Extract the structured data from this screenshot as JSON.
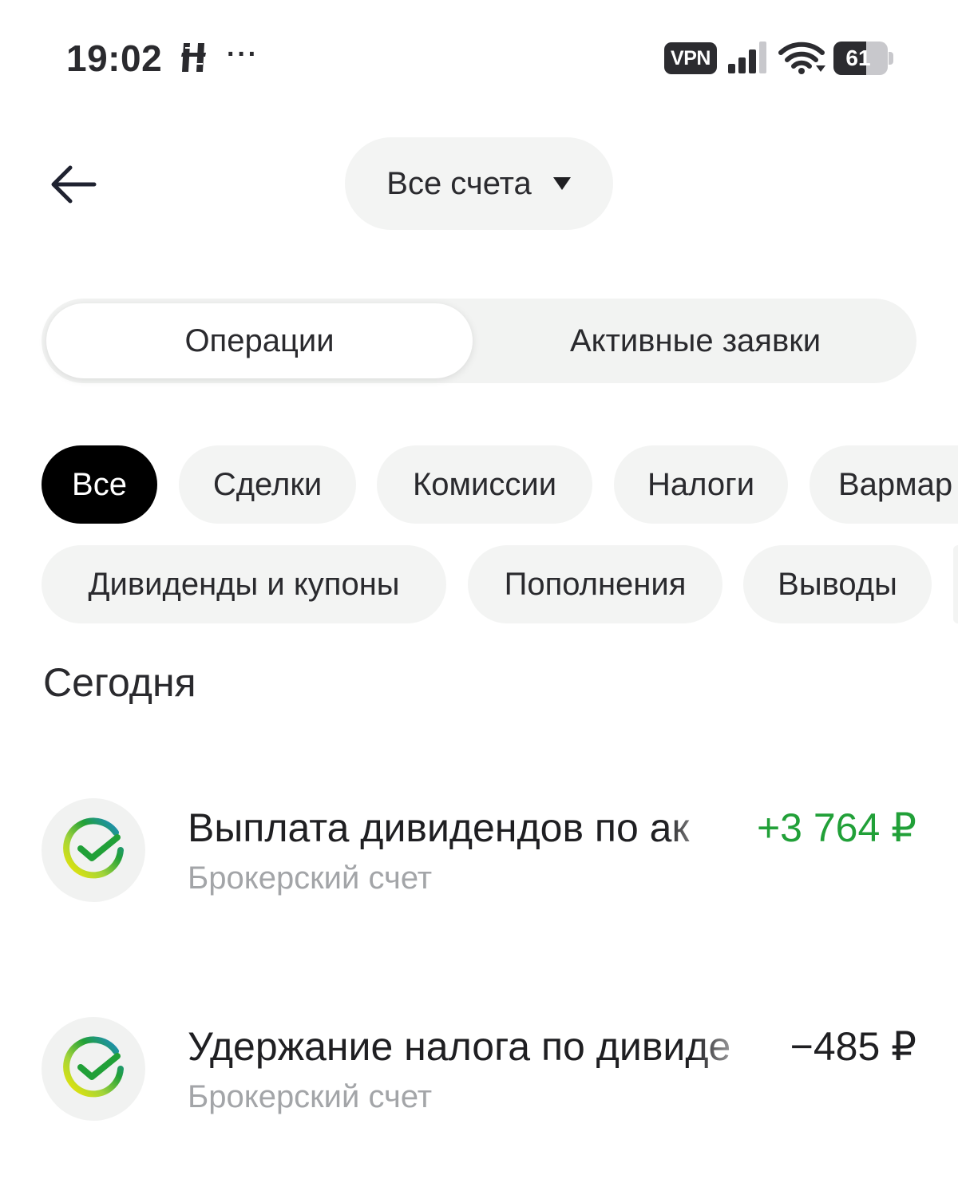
{
  "status_bar": {
    "time": "19:02",
    "vpn": "VPN",
    "battery": "61",
    "battery_level": 0.61
  },
  "header": {
    "account_selector": "Все счета"
  },
  "segments": {
    "operations": "Операции",
    "active_orders": "Активные заявки"
  },
  "filters": {
    "all": "Все",
    "deals": "Сделки",
    "commissions": "Комиссии",
    "taxes": "Налоги",
    "varmar": "Вармар",
    "dividends": "Дивиденды и купоны",
    "deposits": "Пополнения",
    "withdrawals": "Выводы"
  },
  "section": {
    "title": "Сегодня"
  },
  "operations": [
    {
      "title": "Выплата дивидендов по ак",
      "subtitle": "Брокерский счет",
      "amount": "+3 764 ₽",
      "direction": "positive"
    },
    {
      "title": "Удержание налога по дивиде",
      "subtitle": "Брокерский счет",
      "amount": "−485 ₽",
      "direction": "negative"
    }
  ],
  "colors": {
    "positive": "#21a038",
    "chip_active": "#000000",
    "chip_bg": "#f3f4f3"
  }
}
